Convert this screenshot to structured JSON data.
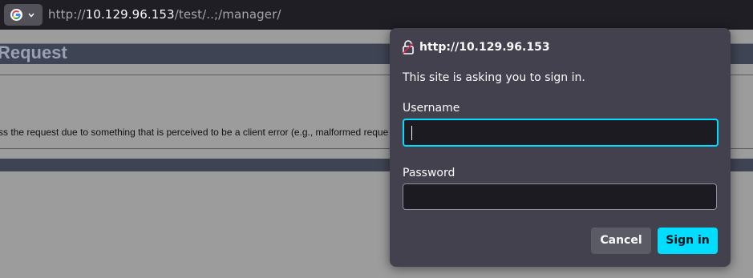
{
  "urlbar": {
    "engine_icon": "google-icon",
    "url_prefix": "http://",
    "url_host": "10.129.96.153",
    "url_path": "/test/..;/manager/"
  },
  "page": {
    "title": "Request",
    "body_text": "ss the request due to something that is perceived to be a client error (e.g., malformed reque"
  },
  "dialog": {
    "icon": "unlocked-lock-icon",
    "origin": "http://10.129.96.153",
    "message": "This site is asking you to sign in.",
    "username_label": "Username",
    "username_value": "",
    "password_label": "Password",
    "password_value": "",
    "cancel_label": "Cancel",
    "signin_label": "Sign in"
  },
  "colors": {
    "accent": "#00ddff",
    "dialog_bg": "#42414d",
    "page_dim": "#9c9c9c",
    "header_bar": "#3f4454"
  }
}
